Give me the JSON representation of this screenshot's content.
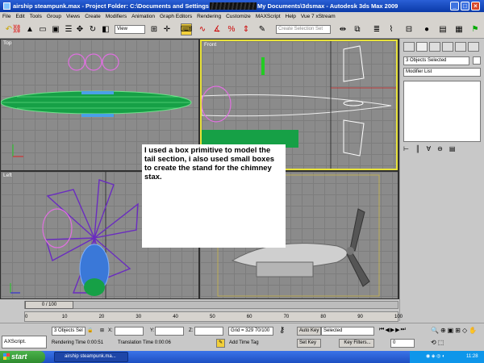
{
  "window": {
    "title_left": "airship steampunk.max   - Project Folder: C:\\Documents and Settings",
    "title_right": "My Documents\\3dsmax    - Autodesk 3ds Max  2009",
    "minimize": "_",
    "maximize": "□",
    "close": "×"
  },
  "menu": [
    "File",
    "Edit",
    "Tools",
    "Group",
    "Views",
    "Create",
    "Modifiers",
    "Animation",
    "Graph Editors",
    "Rendering",
    "Customize",
    "MAXScript",
    "Help",
    "Vue 7 xStream"
  ],
  "toolbar": {
    "coord_dropdown": "View",
    "selection_set_placeholder": "Create Selection Set"
  },
  "viewports": {
    "top": "Top",
    "front": "Front",
    "left": "Left",
    "perspective": ""
  },
  "caption": "I used a box primitive to model the tail section, i also used small boxes to create the stand for the chimney stax.",
  "command_panel": {
    "object_name": "3 Objects Selected",
    "modifier_list": "Modifier List"
  },
  "timeline": {
    "frame_counter": "0 / 100",
    "ticks": [
      "0",
      "10",
      "20",
      "30",
      "40",
      "50",
      "60",
      "70",
      "80",
      "90",
      "100"
    ]
  },
  "status": {
    "maxscript_label": "AXScript.",
    "selection": "3 Objects Sel",
    "x_label": "X:",
    "y_label": "Y:",
    "z_label": "Z:",
    "grid": "Grid = 329 70/100",
    "auto_key": "Auto Key",
    "selected": "Selected",
    "set_key": "Set Key",
    "key_filters": "Key Filters...",
    "rendering_time": "Rendering Time  0:00:51",
    "translation_time": "Translation Time  0:00:06",
    "add_time_tag": "Add Time Tag",
    "frame_value": "0"
  },
  "taskbar": {
    "start": "start",
    "task": "airship steampunk.ma...",
    "lang": "EN",
    "clock": "11:28"
  },
  "colors": {
    "selected_viewport_border": "#e8e23a",
    "hull_green": "#20c050",
    "prop_purple": "#6a2cc0",
    "balloon_pink": "#e070e0"
  }
}
